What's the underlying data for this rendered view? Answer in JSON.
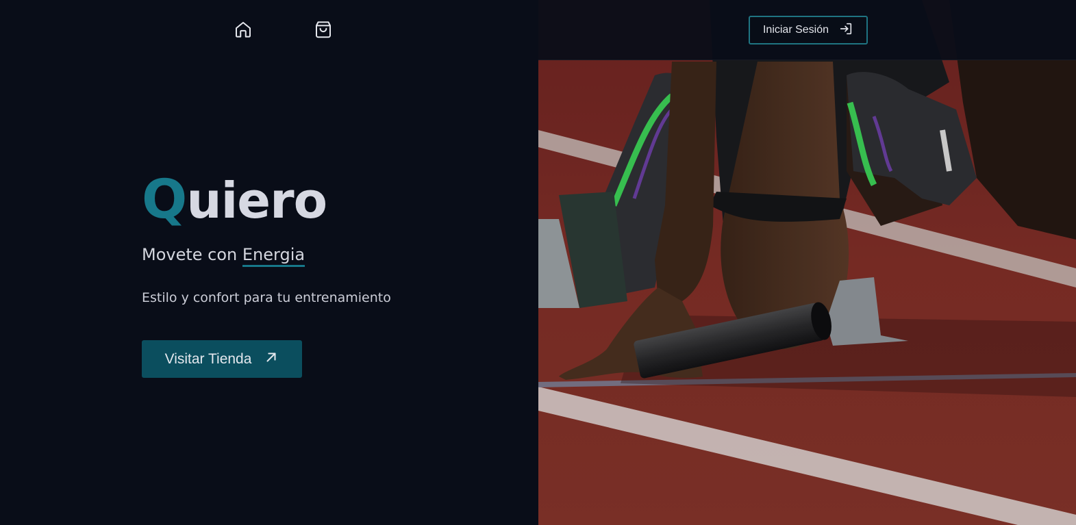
{
  "nav": {
    "home_icon": "home-icon",
    "cart_icon": "shopping-bag-icon",
    "login_label": "Iniciar Sesión",
    "login_icon": "log-in-icon"
  },
  "hero": {
    "brand_initial": "Q",
    "brand_rest": "uiero",
    "tagline_prefix": "Movete con ",
    "tagline_accent": "Energia",
    "subtitle": "Estilo y confort para tu entrenamiento",
    "cta_label": "Visitar Tienda",
    "cta_icon": "arrow-up-right-icon",
    "image": "Athlete in sprint starting blocks on a red running track holding a relay baton"
  },
  "colors": {
    "background": "#090d18",
    "accent": "#17788a",
    "cta_background": "#0b4e5e",
    "track": "#7e2d27"
  }
}
